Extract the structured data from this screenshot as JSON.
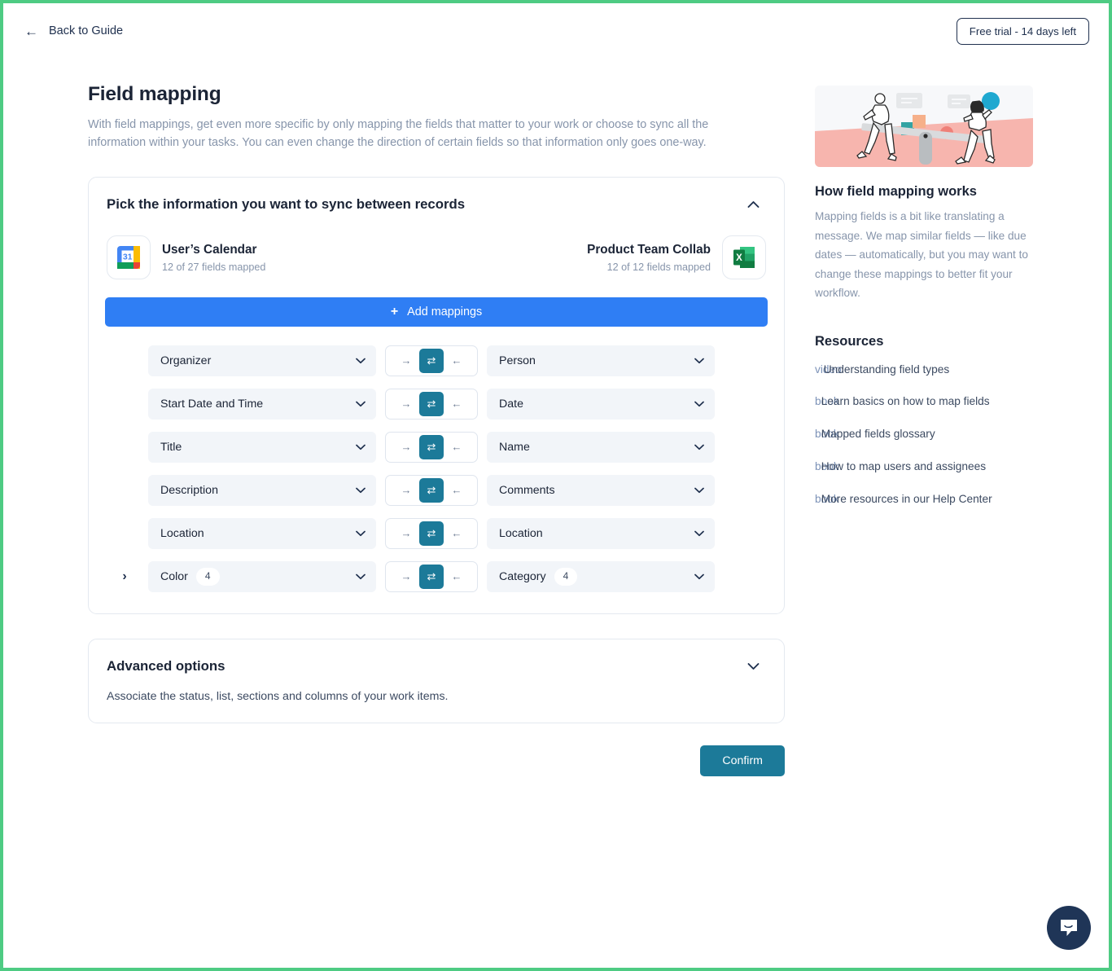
{
  "topbar": {
    "back_label": "Back to Guide",
    "back_icon": "arrow-left-icon",
    "trial_badge": "Free trial - 14 days left"
  },
  "header": {
    "title": "Field mapping",
    "description": "With field mappings, get even more specific by only mapping the fields that matter to your work or choose to sync all the information within your tasks. You can even change the direction of certain fields so that information only goes one-way."
  },
  "sync_card": {
    "title": "Pick the information you want to sync between records",
    "collapse_icon": "chevron-up-icon",
    "left_app": {
      "name": "User’s Calendar",
      "fields_mapped": "12 of 27 fields mapped",
      "icon": "google-calendar-icon"
    },
    "right_app": {
      "name": "Product Team Collab",
      "fields_mapped": "12 of 12 fields mapped",
      "icon": "microsoft-excel-icon"
    },
    "add_button": "Add mappings",
    "add_icon": "plus-icon",
    "direction": {
      "right_label": "→",
      "both_label": "⇄",
      "left_label": "←",
      "selected": "both"
    },
    "rows": [
      {
        "left": "Organizer",
        "left_count": "",
        "right": "Person",
        "right_count": "",
        "expandable": false
      },
      {
        "left": "Start Date and Time",
        "left_count": "",
        "right": "Date",
        "right_count": "",
        "expandable": false
      },
      {
        "left": "Title",
        "left_count": "",
        "right": "Name",
        "right_count": "",
        "expandable": false
      },
      {
        "left": "Description",
        "left_count": "",
        "right": "Comments",
        "right_count": "",
        "expandable": false
      },
      {
        "left": "Location",
        "left_count": "",
        "right": "Location",
        "right_count": "",
        "expandable": false
      },
      {
        "left": "Color",
        "left_count": "4",
        "right": "Category",
        "right_count": "4",
        "expandable": true
      }
    ]
  },
  "advanced": {
    "title": "Advanced options",
    "expand_icon": "chevron-down-icon",
    "subtitle": "Associate the status, list, sections and columns of your work items."
  },
  "footer": {
    "confirm_label": "Confirm"
  },
  "sidebar": {
    "illustration": "seesaw-illustration",
    "how_title": "How field mapping works",
    "how_body": "Mapping fields is a bit like translating a message. We map similar fields — like due dates — automatically, but you may want to change these mappings to better fit your workflow.",
    "resources_title": "Resources",
    "resources": [
      {
        "icon_text": "video",
        "label": "Understanding field types"
      },
      {
        "icon_text": "book",
        "label": "Learn basics on how to map fields"
      },
      {
        "icon_text": "book",
        "label": "Mapped fields glossary"
      },
      {
        "icon_text": "book",
        "label": "How to map users and assignees"
      },
      {
        "icon_text": "book",
        "label": "More resources in our Help Center"
      }
    ]
  },
  "chat": {
    "icon": "chat-bubble-icon"
  },
  "colors": {
    "accent_blue": "#2f7ef4",
    "accent_teal": "#1c7a99",
    "page_border_green": "#4ecb83",
    "muted_text": "#8795ab",
    "dark_navy": "#1f3557"
  }
}
